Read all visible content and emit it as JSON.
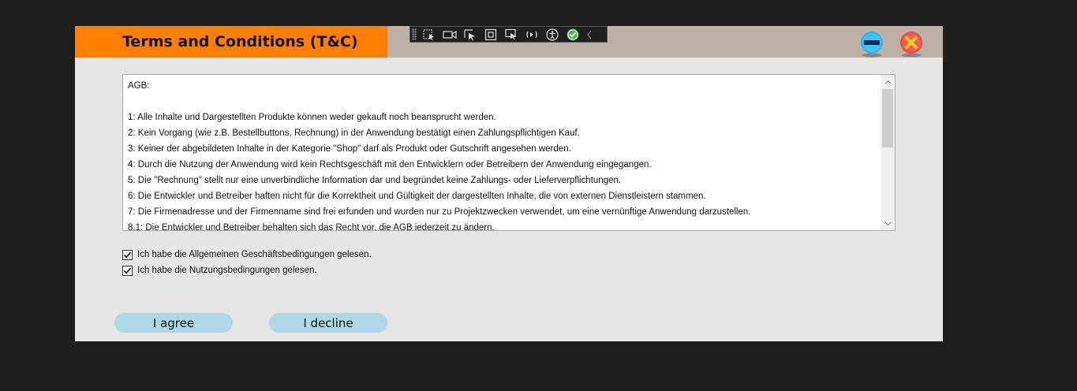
{
  "window": {
    "title": "Terms and Conditions (T&C)",
    "accent_color": "#ff8000",
    "titlebar_color": "#bcb0a7",
    "background_color": "#e6e6e6"
  },
  "debug_toolbar": {
    "icons": [
      "select-element-icon",
      "video-icon",
      "pointer-select-icon",
      "layout-adorner-icon",
      "track-focus-icon",
      "hot-reload-icon",
      "accessibility-icon",
      "check-circle-icon",
      "chevron-left-icon"
    ]
  },
  "titlebar_buttons": {
    "minimize": "minimize-icon",
    "close": "close-icon"
  },
  "terms_text": {
    "lines": [
      "AGB:",
      "",
      "1: Alle Inhalte und Dargestellten Produkte können weder gekauft noch beansprucht werden.",
      "2: Kein Vorgang (wie z.B. Bestellbuttons, Rechnung) in der Anwendung bestätigt einen Zahlungspflichtigen Kauf.",
      "3: Keiner der abgebildeten Inhalte in der Kategorie \"Shop\" darf als Produkt oder Gutschrift angesehen werden.",
      "4: Durch die Nutzung der Anwendung wird kein Rechtsgeschäft mit den Entwicklern oder Betreibern der Anwendung eingegangen.",
      "5: Die \"Rechnung\" stellt nur eine unverbindliche Information dar und begründet keine Zahlungs- oder Lieferverpflichtungen.",
      "6: Die Entwickler und Betreiber haften nicht für die Korrektheit und Gültigkeit der dargestellten Inhalte, die von externen Dienstleistern stammen.",
      "7: Die Firmenadresse und der Firmenname sind frei erfunden und wurden nur zu Projektzwecken verwendet, um eine vernünftige Anwendung darzustellen.",
      "8.1: Die Entwickler und Betreiber behalten sich das Recht vor, die AGB jederzeit zu ändern."
    ]
  },
  "checkboxes": [
    {
      "label": "Ich habe die Allgemeinen Geschäftsbedingungen gelesen.",
      "checked": true
    },
    {
      "label": "Ich habe die Nutzungsbedingungen gelesen.",
      "checked": true
    }
  ],
  "buttons": {
    "agree": "I agree",
    "decline": "I decline",
    "color": "#add8e6"
  }
}
